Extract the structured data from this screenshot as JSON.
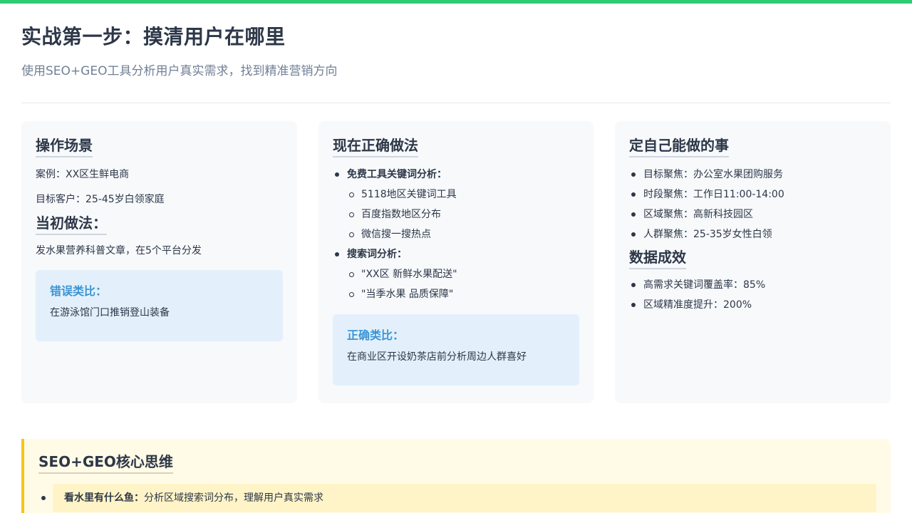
{
  "accent_color": "#2ecc71",
  "header": {
    "title": "实战第一步：摸清用户在哪里",
    "subtitle": "使用SEO+GEO工具分析用户真实需求，找到精准营销方向"
  },
  "card1": {
    "title": "操作场景",
    "case": "案例：XX区生鲜电商",
    "target": "目标客户：25-45岁白领家庭",
    "sub_title": "当初做法：",
    "practice": "发水果营养科普文章，在5个平台分发",
    "analogy_title": "错误类比：",
    "analogy_text": "在游泳馆门口推销登山装备"
  },
  "card2": {
    "title": "现在正确做法",
    "group1": "免费工具关键词分析：",
    "group1_items": [
      "5118地区关键词工具",
      "百度指数地区分布",
      "微信搜一搜热点"
    ],
    "group2": "搜索词分析：",
    "group2_items": [
      "\"XX区 新鲜水果配送\"",
      "\"当季水果 品质保障\""
    ],
    "analogy_title": "正确类比：",
    "analogy_text": "在商业区开设奶茶店前分析周边人群喜好"
  },
  "card3": {
    "title": "定自己能做的事",
    "items": [
      "目标聚焦：办公室水果团购服务",
      "时段聚焦：工作日11:00-14:00",
      "区域聚焦：高新科技园区",
      "人群聚焦：25-35岁女性白领"
    ],
    "sub_title": "数据成效",
    "results": [
      "高需求关键词覆盖率：85%",
      "区域精准度提升：200%"
    ]
  },
  "core": {
    "title": "SEO+GEO核心思维",
    "item1_label": "看水里有什么鱼：",
    "item1_text": "分析区域搜索词分布，理解用户真实需求"
  }
}
